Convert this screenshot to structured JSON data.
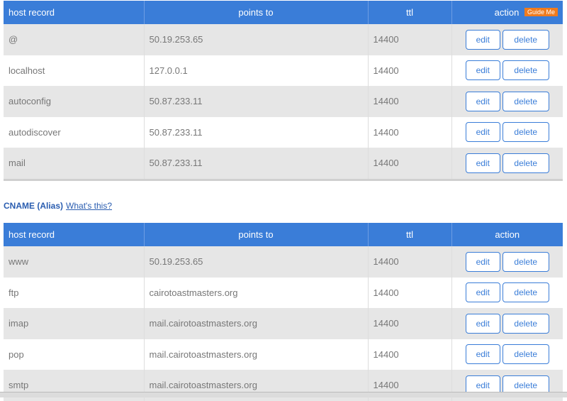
{
  "a_records": {
    "headers": {
      "host": "host record",
      "points": "points to",
      "ttl": "ttl",
      "action": "action",
      "guide": "Guide Me"
    },
    "rows": [
      {
        "host": "@",
        "points": "50.19.253.65",
        "ttl": "14400"
      },
      {
        "host": "localhost",
        "points": "127.0.0.1",
        "ttl": "14400"
      },
      {
        "host": "autoconfig",
        "points": "50.87.233.11",
        "ttl": "14400"
      },
      {
        "host": "autodiscover",
        "points": "50.87.233.11",
        "ttl": "14400"
      },
      {
        "host": "mail",
        "points": "50.87.233.11",
        "ttl": "14400"
      }
    ]
  },
  "cname": {
    "title": "CNAME (Alias)",
    "help_link": "What's this?",
    "headers": {
      "host": "host record",
      "points": "points to",
      "ttl": "ttl",
      "action": "action"
    },
    "rows": [
      {
        "host": "www",
        "points": "50.19.253.65",
        "ttl": "14400"
      },
      {
        "host": "ftp",
        "points": "cairotoastmasters.org",
        "ttl": "14400"
      },
      {
        "host": "imap",
        "points": "mail.cairotoastmasters.org",
        "ttl": "14400"
      },
      {
        "host": "pop",
        "points": "mail.cairotoastmasters.org",
        "ttl": "14400"
      },
      {
        "host": "smtp",
        "points": "mail.cairotoastmasters.org",
        "ttl": "14400"
      }
    ]
  },
  "actions": {
    "edit": "edit",
    "delete": "delete"
  }
}
